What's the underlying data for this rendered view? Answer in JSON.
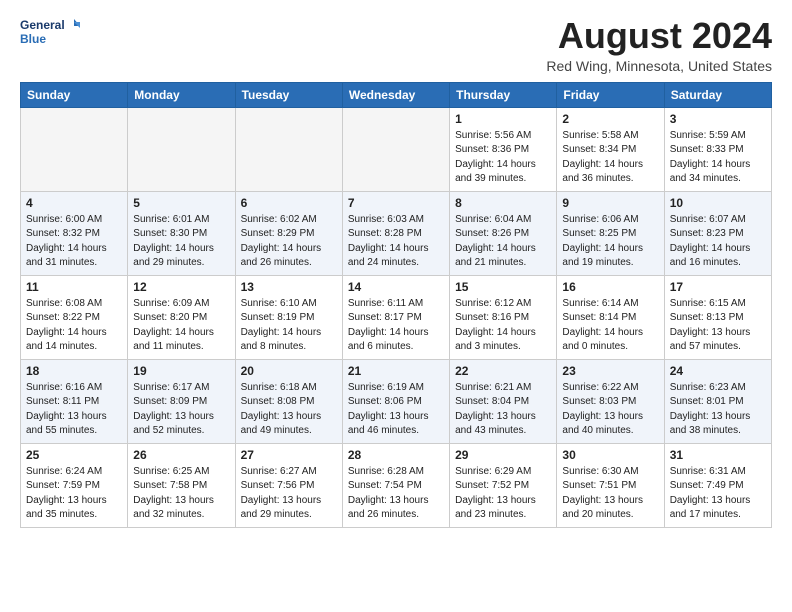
{
  "header": {
    "logo_line1": "General",
    "logo_line2": "Blue",
    "month_title": "August 2024",
    "location": "Red Wing, Minnesota, United States"
  },
  "weekdays": [
    "Sunday",
    "Monday",
    "Tuesday",
    "Wednesday",
    "Thursday",
    "Friday",
    "Saturday"
  ],
  "weeks": [
    [
      {
        "day": "",
        "info": ""
      },
      {
        "day": "",
        "info": ""
      },
      {
        "day": "",
        "info": ""
      },
      {
        "day": "",
        "info": ""
      },
      {
        "day": "1",
        "info": "Sunrise: 5:56 AM\nSunset: 8:36 PM\nDaylight: 14 hours\nand 39 minutes."
      },
      {
        "day": "2",
        "info": "Sunrise: 5:58 AM\nSunset: 8:34 PM\nDaylight: 14 hours\nand 36 minutes."
      },
      {
        "day": "3",
        "info": "Sunrise: 5:59 AM\nSunset: 8:33 PM\nDaylight: 14 hours\nand 34 minutes."
      }
    ],
    [
      {
        "day": "4",
        "info": "Sunrise: 6:00 AM\nSunset: 8:32 PM\nDaylight: 14 hours\nand 31 minutes."
      },
      {
        "day": "5",
        "info": "Sunrise: 6:01 AM\nSunset: 8:30 PM\nDaylight: 14 hours\nand 29 minutes."
      },
      {
        "day": "6",
        "info": "Sunrise: 6:02 AM\nSunset: 8:29 PM\nDaylight: 14 hours\nand 26 minutes."
      },
      {
        "day": "7",
        "info": "Sunrise: 6:03 AM\nSunset: 8:28 PM\nDaylight: 14 hours\nand 24 minutes."
      },
      {
        "day": "8",
        "info": "Sunrise: 6:04 AM\nSunset: 8:26 PM\nDaylight: 14 hours\nand 21 minutes."
      },
      {
        "day": "9",
        "info": "Sunrise: 6:06 AM\nSunset: 8:25 PM\nDaylight: 14 hours\nand 19 minutes."
      },
      {
        "day": "10",
        "info": "Sunrise: 6:07 AM\nSunset: 8:23 PM\nDaylight: 14 hours\nand 16 minutes."
      }
    ],
    [
      {
        "day": "11",
        "info": "Sunrise: 6:08 AM\nSunset: 8:22 PM\nDaylight: 14 hours\nand 14 minutes."
      },
      {
        "day": "12",
        "info": "Sunrise: 6:09 AM\nSunset: 8:20 PM\nDaylight: 14 hours\nand 11 minutes."
      },
      {
        "day": "13",
        "info": "Sunrise: 6:10 AM\nSunset: 8:19 PM\nDaylight: 14 hours\nand 8 minutes."
      },
      {
        "day": "14",
        "info": "Sunrise: 6:11 AM\nSunset: 8:17 PM\nDaylight: 14 hours\nand 6 minutes."
      },
      {
        "day": "15",
        "info": "Sunrise: 6:12 AM\nSunset: 8:16 PM\nDaylight: 14 hours\nand 3 minutes."
      },
      {
        "day": "16",
        "info": "Sunrise: 6:14 AM\nSunset: 8:14 PM\nDaylight: 14 hours\nand 0 minutes."
      },
      {
        "day": "17",
        "info": "Sunrise: 6:15 AM\nSunset: 8:13 PM\nDaylight: 13 hours\nand 57 minutes."
      }
    ],
    [
      {
        "day": "18",
        "info": "Sunrise: 6:16 AM\nSunset: 8:11 PM\nDaylight: 13 hours\nand 55 minutes."
      },
      {
        "day": "19",
        "info": "Sunrise: 6:17 AM\nSunset: 8:09 PM\nDaylight: 13 hours\nand 52 minutes."
      },
      {
        "day": "20",
        "info": "Sunrise: 6:18 AM\nSunset: 8:08 PM\nDaylight: 13 hours\nand 49 minutes."
      },
      {
        "day": "21",
        "info": "Sunrise: 6:19 AM\nSunset: 8:06 PM\nDaylight: 13 hours\nand 46 minutes."
      },
      {
        "day": "22",
        "info": "Sunrise: 6:21 AM\nSunset: 8:04 PM\nDaylight: 13 hours\nand 43 minutes."
      },
      {
        "day": "23",
        "info": "Sunrise: 6:22 AM\nSunset: 8:03 PM\nDaylight: 13 hours\nand 40 minutes."
      },
      {
        "day": "24",
        "info": "Sunrise: 6:23 AM\nSunset: 8:01 PM\nDaylight: 13 hours\nand 38 minutes."
      }
    ],
    [
      {
        "day": "25",
        "info": "Sunrise: 6:24 AM\nSunset: 7:59 PM\nDaylight: 13 hours\nand 35 minutes."
      },
      {
        "day": "26",
        "info": "Sunrise: 6:25 AM\nSunset: 7:58 PM\nDaylight: 13 hours\nand 32 minutes."
      },
      {
        "day": "27",
        "info": "Sunrise: 6:27 AM\nSunset: 7:56 PM\nDaylight: 13 hours\nand 29 minutes."
      },
      {
        "day": "28",
        "info": "Sunrise: 6:28 AM\nSunset: 7:54 PM\nDaylight: 13 hours\nand 26 minutes."
      },
      {
        "day": "29",
        "info": "Sunrise: 6:29 AM\nSunset: 7:52 PM\nDaylight: 13 hours\nand 23 minutes."
      },
      {
        "day": "30",
        "info": "Sunrise: 6:30 AM\nSunset: 7:51 PM\nDaylight: 13 hours\nand 20 minutes."
      },
      {
        "day": "31",
        "info": "Sunrise: 6:31 AM\nSunset: 7:49 PM\nDaylight: 13 hours\nand 17 minutes."
      }
    ]
  ]
}
